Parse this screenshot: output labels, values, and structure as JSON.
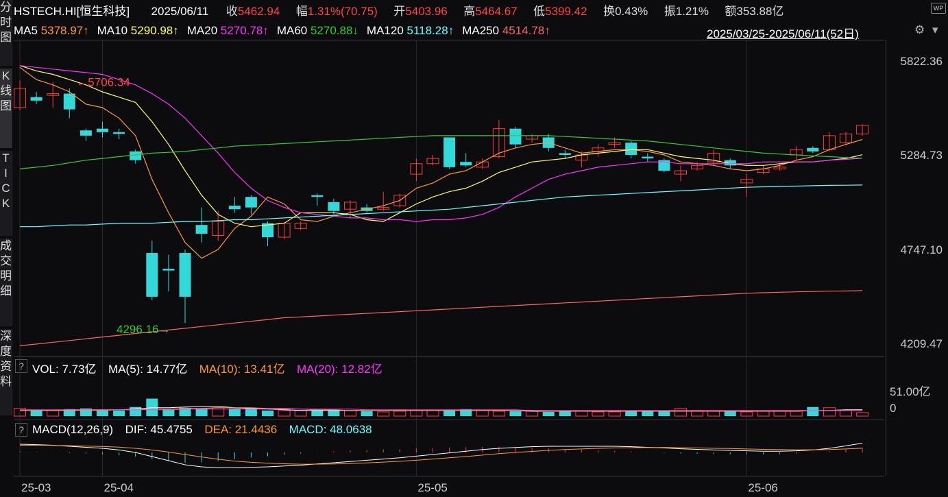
{
  "header": {
    "symbol": "HSTECH.HI[恒生科技]",
    "date": "2025/06/11",
    "close_label": "收",
    "close": "5462.94",
    "change_label": "幅",
    "change": "1.31%(70.75)",
    "open_label": "开",
    "open": "5403.96",
    "high_label": "高",
    "high": "5464.67",
    "low_label": "低",
    "low": "5399.42",
    "turnover_label": "换",
    "turnover": "0.43%",
    "amplitude_label": "振",
    "amplitude": "1.21%",
    "amount_label": "额",
    "amount": "353.88亿",
    "wp_badge": "WP",
    "range": "2025/03/25-2025/06/11(52日)",
    "gear": "⚙",
    "chevron": "▾"
  },
  "ma": [
    {
      "label": "MA5",
      "value": "5378.97↑",
      "color": "#ff9933"
    },
    {
      "label": "MA10",
      "value": "5290.98↑",
      "color": "#ffff66"
    },
    {
      "label": "MA20",
      "value": "5270.78↑",
      "color": "#ff33ff"
    },
    {
      "label": "MA60",
      "value": "5270.88↓",
      "color": "#33cc33"
    },
    {
      "label": "MA120",
      "value": "5118.28↑",
      "color": "#66ffff"
    },
    {
      "label": "MA250",
      "value": "4514.78↑",
      "color": "#ff6666"
    }
  ],
  "sidebar": [
    {
      "label": "分\n时\n图",
      "active": false
    },
    {
      "label": "K\n线\n图",
      "active": true
    },
    {
      "label": "T\nI\nC\nK",
      "active": false
    },
    {
      "label": "成\n交\n明\n细",
      "active": false
    },
    {
      "label": "深\n度\n资\n料",
      "active": false
    }
  ],
  "volume": {
    "help": "?",
    "vol_label": "VOL: 7.73亿",
    "ma5_label": "MA(5): 14.77亿",
    "ma10_label": "MA(10): 13.41亿",
    "ma20_label": "MA(20): 12.82亿",
    "axis_top": "51.00亿",
    "axis_zero": "0"
  },
  "macd": {
    "help": "?",
    "params": "MACD(12,26,9)",
    "dif_label": "DIF: 45.4755",
    "dea_label": "DEA: 21.4436",
    "macd_label": "MACD: 48.0638"
  },
  "chart_data": {
    "type": "candlestick",
    "price_ticks": [
      "5822.36",
      "5284.73",
      "4747.10",
      "4209.47"
    ],
    "price_tick_values": [
      5822.36,
      5284.73,
      4747.1,
      4209.47
    ],
    "ylim": [
      4209.47,
      5822.36
    ],
    "x_ticks": [
      {
        "label": "25-03",
        "index": 0
      },
      {
        "label": "25-04",
        "index": 5
      },
      {
        "label": "25-05",
        "index": 24
      },
      {
        "label": "25-06",
        "index": 44
      }
    ],
    "annotations": [
      {
        "text": "5706.34",
        "index": 3,
        "value": 5706.34,
        "color": "#ff4444",
        "side": "left"
      },
      {
        "text": "4296.16",
        "index": 10,
        "value": 4296.16,
        "color": "#33cc33",
        "side": "right"
      }
    ],
    "candles": [
      {
        "o": 5560,
        "c": 5670,
        "h": 5715,
        "l": 5545
      },
      {
        "o": 5620,
        "c": 5600,
        "h": 5650,
        "l": 5580
      },
      {
        "o": 5630,
        "c": 5640,
        "h": 5706,
        "l": 5560
      },
      {
        "o": 5640,
        "c": 5550,
        "h": 5670,
        "l": 5500
      },
      {
        "o": 5430,
        "c": 5400,
        "h": 5440,
        "l": 5370
      },
      {
        "o": 5440,
        "c": 5420,
        "h": 5480,
        "l": 5390
      },
      {
        "o": 5420,
        "c": 5410,
        "h": 5440,
        "l": 5380
      },
      {
        "o": 5310,
        "c": 5260,
        "h": 5320,
        "l": 5240
      },
      {
        "o": 4730,
        "c": 4480,
        "h": 4800,
        "l": 4460
      },
      {
        "o": 4640,
        "c": 4630,
        "h": 4720,
        "l": 4510
      },
      {
        "o": 4730,
        "c": 4480,
        "h": 4750,
        "l": 4330
      },
      {
        "o": 4890,
        "c": 4840,
        "h": 4990,
        "l": 4790
      },
      {
        "o": 4830,
        "c": 4910,
        "h": 4970,
        "l": 4800
      },
      {
        "o": 5000,
        "c": 4980,
        "h": 5050,
        "l": 4960
      },
      {
        "o": 5050,
        "c": 4990,
        "h": 5060,
        "l": 4950
      },
      {
        "o": 4900,
        "c": 4820,
        "h": 4910,
        "l": 4770
      },
      {
        "o": 4820,
        "c": 4900,
        "h": 4905,
        "l": 4810
      },
      {
        "o": 4870,
        "c": 4900,
        "h": 4910,
        "l": 4860
      },
      {
        "o": 5060,
        "c": 5050,
        "h": 5070,
        "l": 5000
      },
      {
        "o": 5020,
        "c": 4970,
        "h": 5040,
        "l": 4950
      },
      {
        "o": 4980,
        "c": 5020,
        "h": 5030,
        "l": 4930
      },
      {
        "o": 4990,
        "c": 4970,
        "h": 5010,
        "l": 4960
      },
      {
        "o": 4980,
        "c": 4990,
        "h": 5080,
        "l": 4970
      },
      {
        "o": 5000,
        "c": 5060,
        "h": 5070,
        "l": 4990
      },
      {
        "o": 5180,
        "c": 5240,
        "h": 5270,
        "l": 5140
      },
      {
        "o": 5240,
        "c": 5270,
        "h": 5290,
        "l": 5230
      },
      {
        "o": 5390,
        "c": 5220,
        "h": 5390,
        "l": 5210
      },
      {
        "o": 5250,
        "c": 5230,
        "h": 5300,
        "l": 5220
      },
      {
        "o": 5220,
        "c": 5250,
        "h": 5270,
        "l": 5210
      },
      {
        "o": 5280,
        "c": 5440,
        "h": 5490,
        "l": 5270
      },
      {
        "o": 5440,
        "c": 5350,
        "h": 5450,
        "l": 5330
      },
      {
        "o": 5380,
        "c": 5400,
        "h": 5410,
        "l": 5360
      },
      {
        "o": 5390,
        "c": 5330,
        "h": 5410,
        "l": 5310
      },
      {
        "o": 5300,
        "c": 5290,
        "h": 5320,
        "l": 5270
      },
      {
        "o": 5260,
        "c": 5290,
        "h": 5310,
        "l": 5220
      },
      {
        "o": 5310,
        "c": 5330,
        "h": 5350,
        "l": 5280
      },
      {
        "o": 5350,
        "c": 5360,
        "h": 5390,
        "l": 5330
      },
      {
        "o": 5360,
        "c": 5290,
        "h": 5370,
        "l": 5270
      },
      {
        "o": 5280,
        "c": 5270,
        "h": 5300,
        "l": 5250
      },
      {
        "o": 5260,
        "c": 5200,
        "h": 5270,
        "l": 5190
      },
      {
        "o": 5180,
        "c": 5200,
        "h": 5230,
        "l": 5140
      },
      {
        "o": 5210,
        "c": 5230,
        "h": 5250,
        "l": 5200
      },
      {
        "o": 5250,
        "c": 5300,
        "h": 5320,
        "l": 5230
      },
      {
        "o": 5260,
        "c": 5230,
        "h": 5270,
        "l": 5210
      },
      {
        "o": 5130,
        "c": 5150,
        "h": 5180,
        "l": 5050
      },
      {
        "o": 5190,
        "c": 5210,
        "h": 5230,
        "l": 5180
      },
      {
        "o": 5210,
        "c": 5220,
        "h": 5240,
        "l": 5200
      },
      {
        "o": 5290,
        "c": 5320,
        "h": 5340,
        "l": 5260
      },
      {
        "o": 5330,
        "c": 5310,
        "h": 5340,
        "l": 5300
      },
      {
        "o": 5320,
        "c": 5400,
        "h": 5420,
        "l": 5310
      },
      {
        "o": 5360,
        "c": 5410,
        "h": 5420,
        "l": 5350
      },
      {
        "o": 5410,
        "c": 5460,
        "h": 5465,
        "l": 5400
      }
    ],
    "ma_lines": {
      "MA5": [
        5790,
        5720,
        5690,
        5650,
        5580,
        5560,
        5500,
        5400,
        5150,
        4960,
        4790,
        4700,
        4750,
        4870,
        4940,
        5050,
        5010,
        4920,
        4910,
        4940,
        4960,
        4980,
        5000,
        5030,
        5100,
        5130,
        5180,
        5200,
        5250,
        5300,
        5330,
        5350,
        5360,
        5330,
        5300,
        5310,
        5320,
        5320,
        5310,
        5290,
        5250,
        5240,
        5230,
        5210,
        5200,
        5210,
        5230,
        5260,
        5280,
        5320,
        5350,
        5378
      ],
      "MA10": [
        5800,
        5770,
        5750,
        5720,
        5690,
        5650,
        5620,
        5590,
        5480,
        5350,
        5200,
        5060,
        4950,
        4900,
        4880,
        4890,
        4900,
        4960,
        4960,
        4960,
        4950,
        4920,
        4910,
        4960,
        5010,
        5050,
        5080,
        5100,
        5140,
        5190,
        5220,
        5250,
        5260,
        5270,
        5290,
        5300,
        5310,
        5320,
        5320,
        5300,
        5280,
        5270,
        5260,
        5240,
        5230,
        5230,
        5240,
        5250,
        5250,
        5260,
        5270,
        5291
      ],
      "MA20": [
        5800,
        5790,
        5780,
        5770,
        5760,
        5750,
        5720,
        5690,
        5640,
        5580,
        5500,
        5400,
        5300,
        5190,
        5100,
        5030,
        4990,
        4960,
        4950,
        4940,
        4930,
        4930,
        4920,
        4920,
        4910,
        4920,
        4920,
        4930,
        4950,
        4990,
        5050,
        5100,
        5150,
        5180,
        5200,
        5220,
        5230,
        5240,
        5250,
        5250,
        5240,
        5240,
        5240,
        5240,
        5240,
        5250,
        5250,
        5250,
        5250,
        5260,
        5265,
        5271
      ],
      "MA60": [
        5210,
        5220,
        5230,
        5245,
        5260,
        5270,
        5280,
        5290,
        5300,
        5305,
        5310,
        5320,
        5330,
        5340,
        5345,
        5350,
        5355,
        5360,
        5365,
        5370,
        5375,
        5380,
        5385,
        5390,
        5395,
        5400,
        5400,
        5400,
        5400,
        5400,
        5400,
        5400,
        5400,
        5395,
        5390,
        5385,
        5380,
        5375,
        5370,
        5360,
        5350,
        5340,
        5330,
        5320,
        5310,
        5300,
        5295,
        5290,
        5285,
        5280,
        5275,
        5271
      ],
      "MA120": [
        4880,
        4880,
        4885,
        4890,
        4890,
        4895,
        4900,
        4900,
        4900,
        4905,
        4910,
        4910,
        4915,
        4920,
        4920,
        4925,
        4930,
        4935,
        4940,
        4945,
        4950,
        4955,
        4960,
        4965,
        4970,
        4975,
        4980,
        4990,
        5000,
        5010,
        5020,
        5030,
        5040,
        5050,
        5055,
        5060,
        5065,
        5070,
        5075,
        5080,
        5085,
        5090,
        5095,
        5100,
        5105,
        5108,
        5110,
        5112,
        5114,
        5116,
        5117,
        5118
      ],
      "MA250": [
        4200,
        4210,
        4220,
        4230,
        4240,
        4250,
        4260,
        4270,
        4280,
        4290,
        4300,
        4310,
        4320,
        4330,
        4340,
        4350,
        4360,
        4365,
        4370,
        4375,
        4380,
        4385,
        4390,
        4395,
        4400,
        4405,
        4410,
        4415,
        4420,
        4425,
        4430,
        4435,
        4440,
        4445,
        4450,
        4455,
        4460,
        4465,
        4470,
        4475,
        4480,
        4485,
        4490,
        4495,
        4500,
        4503,
        4506,
        4508,
        4510,
        4512,
        4513,
        4515
      ]
    },
    "volume_bars": [
      11,
      8,
      8,
      10,
      11,
      8,
      8,
      13,
      25,
      10,
      12,
      11,
      12,
      11,
      11,
      8,
      8,
      8,
      8,
      8,
      8,
      7,
      6,
      7,
      8,
      8,
      8,
      10,
      8,
      7,
      7,
      7,
      6,
      7,
      7,
      6,
      6,
      7,
      8,
      7,
      11,
      8,
      7,
      7,
      6,
      7,
      7,
      7,
      13,
      12,
      8,
      5
    ],
    "volume_ma": {
      "MA5": [
        8,
        8,
        8,
        9,
        9,
        9,
        9,
        10,
        12,
        12,
        13,
        14,
        14,
        12,
        11,
        10,
        9,
        8,
        8,
        8,
        8,
        8,
        8,
        8,
        8,
        8,
        8,
        8,
        8,
        8,
        8,
        7,
        7,
        7,
        7,
        7,
        7,
        7,
        7,
        7,
        7,
        7,
        7,
        7,
        7,
        7,
        7,
        7,
        8,
        8,
        9,
        9
      ],
      "MA10": [
        8,
        8,
        8,
        8,
        8,
        8,
        9,
        9,
        10,
        10,
        11,
        11,
        12,
        12,
        12,
        11,
        11,
        10,
        9,
        9,
        8,
        8,
        8,
        8,
        8,
        8,
        8,
        8,
        8,
        8,
        8,
        8,
        7,
        7,
        7,
        7,
        7,
        7,
        7,
        7,
        7,
        7,
        7,
        7,
        7,
        7,
        7,
        7,
        8,
        8,
        8,
        8
      ],
      "MA20": [
        9,
        9,
        9,
        9,
        9,
        9,
        9,
        9,
        9,
        9,
        10,
        10,
        10,
        10,
        10,
        10,
        10,
        10,
        10,
        10,
        10,
        9,
        9,
        9,
        9,
        9,
        9,
        9,
        9,
        9,
        9,
        8,
        8,
        8,
        8,
        8,
        8,
        8,
        8,
        8,
        8,
        8,
        8,
        8,
        8,
        8,
        8,
        8,
        8,
        8,
        8,
        8
      ]
    },
    "macd_series": {
      "DIF": [
        40,
        38,
        35,
        30,
        25,
        20,
        12,
        0,
        -20,
        -40,
        -60,
        -70,
        -75,
        -75,
        -72,
        -70,
        -66,
        -62,
        -56,
        -50,
        -44,
        -38,
        -32,
        -26,
        -18,
        -10,
        -2,
        6,
        14,
        20,
        24,
        28,
        30,
        30,
        30,
        30,
        30,
        28,
        25,
        22,
        18,
        15,
        12,
        10,
        8,
        6,
        6,
        8,
        12,
        20,
        32,
        45
      ],
      "DEA": [
        35,
        35,
        34,
        33,
        31,
        29,
        26,
        20,
        12,
        2,
        -10,
        -22,
        -33,
        -42,
        -48,
        -52,
        -55,
        -57,
        -57,
        -56,
        -54,
        -51,
        -47,
        -43,
        -38,
        -32,
        -26,
        -20,
        -13,
        -6,
        0,
        5,
        10,
        14,
        17,
        20,
        22,
        23,
        24,
        24,
        23,
        22,
        20,
        19,
        17,
        15,
        14,
        13,
        13,
        14,
        17,
        21
      ]
    }
  }
}
